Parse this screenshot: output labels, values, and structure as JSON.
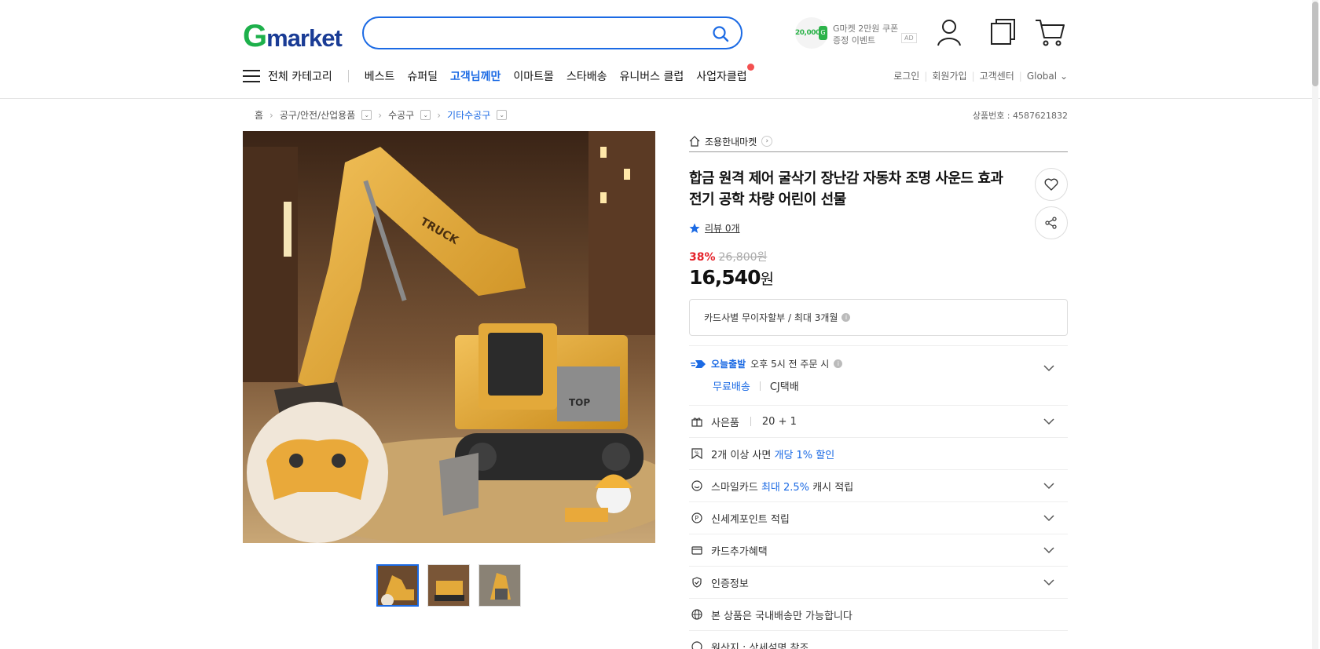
{
  "header": {
    "logo_g": "G",
    "logo_rest": "market",
    "search_placeholder": "",
    "promo": {
      "amount": "20,000",
      "tag": "G",
      "line1": "G마켓 2만원 쿠폰",
      "line2": "증정 이벤트",
      "ad": "AD"
    }
  },
  "nav": {
    "all_categories": "전체 카테고리",
    "items": [
      "베스트",
      "슈퍼딜",
      "고객님께만",
      "이마트몰",
      "스타배송",
      "유니버스 클럽",
      "사업자클럽"
    ],
    "util": [
      "로그인",
      "회원가입",
      "고객센터",
      "Global"
    ]
  },
  "breadcrumb": {
    "home": "홈",
    "levels": [
      "공구/안전/산업용품",
      "수공구",
      "기타수공구"
    ],
    "product_no": "상품번호 : 4587621832"
  },
  "product": {
    "seller": "조용한내마켓",
    "title": "합금 원격 제어 굴삭기 장난감 자동차 조명 사운드 효과 전기 공학 차량 어린이 선물",
    "review": "리뷰 0개",
    "discount_pct": "38%",
    "original_price": "26,800원",
    "price": "16,540",
    "price_unit": "원",
    "installment": "카드사별 무이자할부 / 최대 3개월",
    "image_text_truck": "TRUCK",
    "image_text_top": "TOP"
  },
  "delivery": {
    "today": "오늘출발",
    "cutoff": "오후 5시 전 주문 시",
    "free": "무료배송",
    "carrier": "CJ택배"
  },
  "benefits": {
    "gift_label": "사은품",
    "gift_value": "20 + 1",
    "multi_prefix": "2개 이상 사면",
    "multi_hl": "개당 1% 할인",
    "smile_prefix": "스마일카드",
    "smile_hl": "최대 2.5%",
    "smile_suffix": "캐시 적립",
    "shinsegae": "신세계포인트 적립",
    "card_extra": "카드추가혜택",
    "cert": "인증정보",
    "domestic": "본 상품은 국내배송만 가능합니다",
    "origin": "원산지 : 상세설명 참조"
  },
  "colors": {
    "accent": "#1b6ae4",
    "discount": "#e5232b",
    "brand_green": "#1db04b"
  }
}
